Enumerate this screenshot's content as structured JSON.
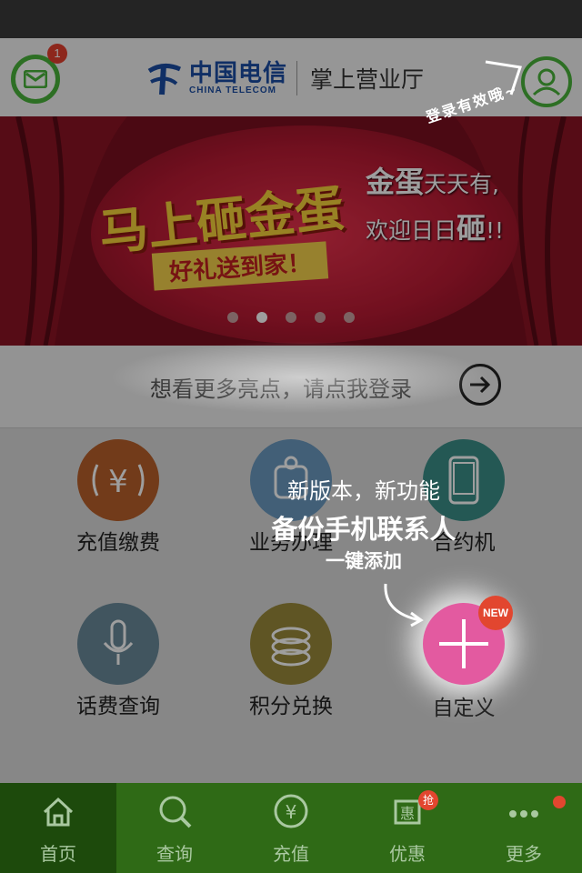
{
  "header": {
    "mail_badge": "1",
    "brand_cn": "中国电信",
    "brand_en": "CHINA TELECOM",
    "app_name": "掌上营业厅",
    "login_tip": "登录有效哦~"
  },
  "banner": {
    "title": "马上砸金蛋",
    "subtitle": "好礼送到家！",
    "promo_line1_bold": "金蛋",
    "promo_line1_rest": "天天有,",
    "promo_line2_rest": "欢迎日日",
    "promo_line2_bold": "砸",
    "promo_line2_end": "!!",
    "active_slide": 2,
    "slide_count": 5
  },
  "login_prompt": "想看更多亮点，请点我登录",
  "services": [
    {
      "label": "充值缴费",
      "icon": "recharge-icon",
      "color": "#b8602a"
    },
    {
      "label": "业务办理",
      "icon": "business-icon",
      "color": "#6b9ac0"
    },
    {
      "label": "合约机",
      "icon": "phone-icon",
      "color": "#3a8e88"
    },
    {
      "label": "话费查询",
      "icon": "microphone-icon",
      "color": "#6a8a9a"
    },
    {
      "label": "积分兑换",
      "icon": "coins-icon",
      "color": "#9a8a3a"
    },
    {
      "label": "自定义",
      "icon": "plus-icon",
      "color": "#e35aa0"
    }
  ],
  "new_badge": "NEW",
  "hint": {
    "line1": "新版本，新功能",
    "line2": "备份手机联系人",
    "line3": "一键添加"
  },
  "tabs": [
    {
      "label": "首页",
      "icon": "home-icon"
    },
    {
      "label": "查询",
      "icon": "search-icon"
    },
    {
      "label": "充值",
      "icon": "yuan-icon"
    },
    {
      "label": "优惠",
      "icon": "coupon-icon",
      "badge": "抢"
    },
    {
      "label": "更多",
      "icon": "more-icon"
    }
  ],
  "colors": {
    "brand_green": "#49b43a",
    "tab_bar": "#2f6a16",
    "telecom_blue": "#1a4da3"
  }
}
